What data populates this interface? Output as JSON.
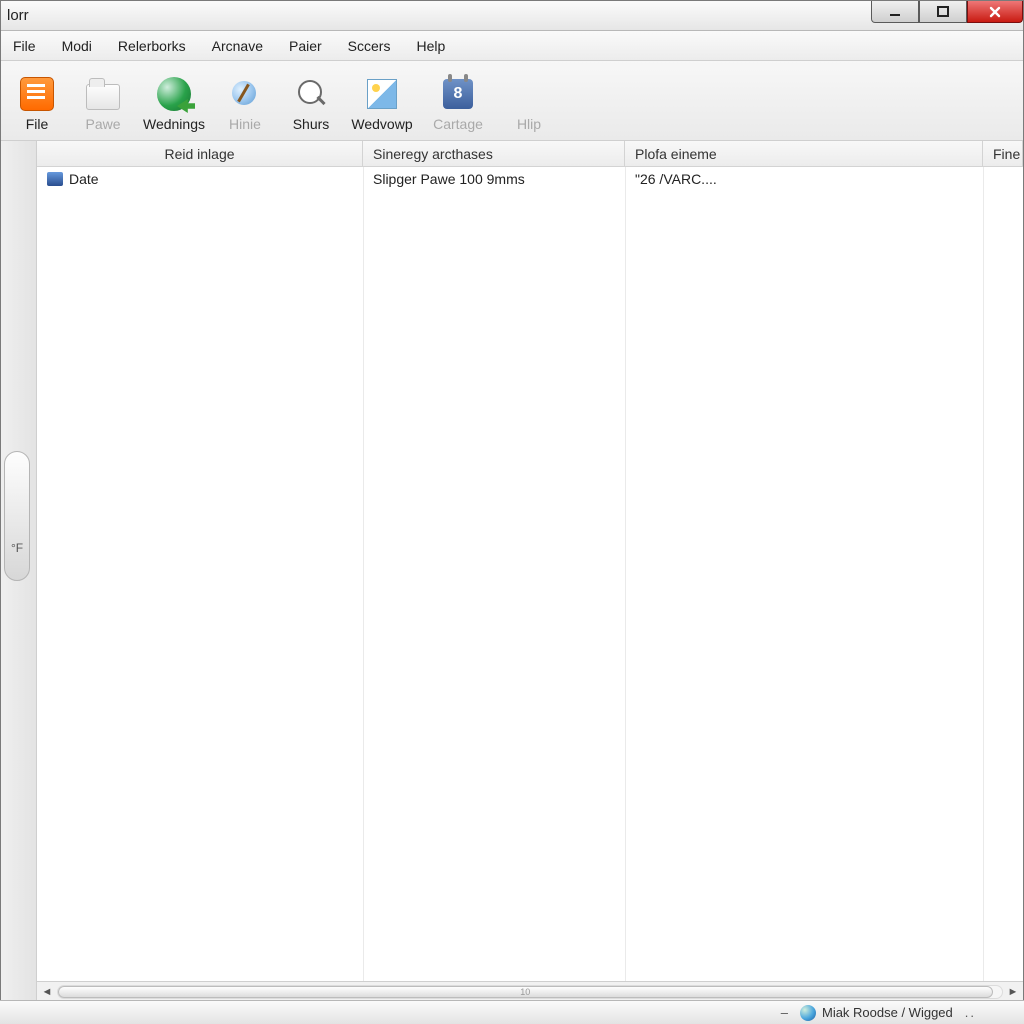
{
  "window": {
    "title": "lorr"
  },
  "menubar": [
    "File",
    "Modi",
    "Relerborks",
    "Arcnave",
    "Paier",
    "Sccers",
    "Help"
  ],
  "toolbar": [
    {
      "label": "File",
      "icon": "orange",
      "enabled": true
    },
    {
      "label": "Pawe",
      "icon": "folder",
      "enabled": false
    },
    {
      "label": "Wednings",
      "icon": "globe",
      "enabled": true
    },
    {
      "label": "Hinie",
      "icon": "brush",
      "enabled": false
    },
    {
      "label": "Shurs",
      "icon": "mag",
      "enabled": true
    },
    {
      "label": "Wedvowp",
      "icon": "pict",
      "enabled": true
    },
    {
      "label": "Cartage",
      "icon": "calbox",
      "enabled": false,
      "badge": "8"
    },
    {
      "label": "Hlip",
      "icon": "",
      "enabled": false
    }
  ],
  "side": {
    "label": "°F"
  },
  "columns": [
    "Reid inlage",
    "Sineregy arcthases",
    "Plofa eineme",
    "Fine"
  ],
  "rows": [
    {
      "c1": "Date",
      "c2": "Slipger Pawe 100 9mms",
      "c3": "\"26 /VARC....",
      "c4": ""
    }
  ],
  "scroll": {
    "thumbLabel": "10"
  },
  "taskbar": {
    "dash": "–",
    "label": "Miak Roodse / Wigged",
    "dots": ".."
  }
}
